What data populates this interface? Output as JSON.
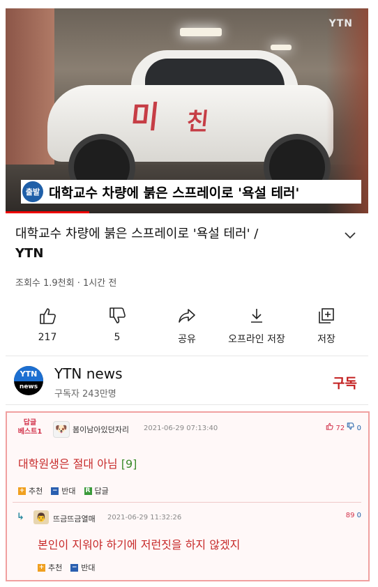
{
  "video": {
    "watermark": "YTN",
    "spray_left": "미",
    "spray_right": "친",
    "caption_badge": "출발",
    "caption_text": "대학교수 차량에 붉은 스프레이로 '욕설 테러'"
  },
  "title": {
    "text": "대학교수 차량에 붉은 스프레이로 '욕설 테러' /",
    "brand": "YTN"
  },
  "meta": "조회수 1.9천회 · 1시간 전",
  "actions": {
    "like": "217",
    "dislike": "5",
    "share": "공유",
    "offline": "오프라인 저장",
    "save": "저장"
  },
  "channel": {
    "logo_top": "YTN",
    "logo_bottom": "news",
    "name": "YTN news",
    "subscribers": "구독자 243만명",
    "subscribe": "구독"
  },
  "comments": {
    "best_label_1": "답글",
    "best_label_2": "베스트1",
    "c1": {
      "user": "봄이남아있던자리",
      "time": "2021-06-29 07:13:40",
      "up": "72",
      "down": "0",
      "text": "대학원생은 절대 아님",
      "count": "[9]",
      "recommend": "추천",
      "oppose": "반대",
      "reply": "답글"
    },
    "c2": {
      "user": "뜨금뜨금열매",
      "time": "2021-06-29 11:32:26",
      "up": "89",
      "down": "0",
      "text": "본인이 지워야 하기에 저런짓을 하지 않겠지",
      "recommend": "추천",
      "oppose": "반대"
    }
  }
}
